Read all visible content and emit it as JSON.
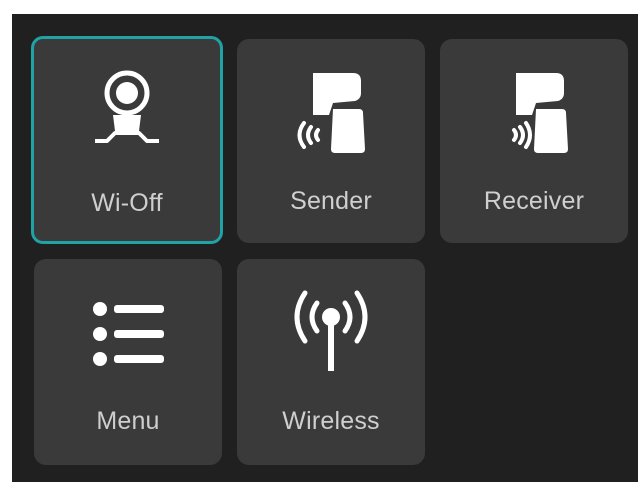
{
  "tiles": [
    {
      "id": "wi-off",
      "label": "Wi-Off",
      "icon": "webcam-icon",
      "selected": true
    },
    {
      "id": "sender",
      "label": "Sender",
      "icon": "sender-icon",
      "selected": false
    },
    {
      "id": "receiver",
      "label": "Receiver",
      "icon": "receiver-icon",
      "selected": false
    },
    {
      "id": "menu",
      "label": "Menu",
      "icon": "list-icon",
      "selected": false
    },
    {
      "id": "wireless",
      "label": "Wireless",
      "icon": "antenna-icon",
      "selected": false
    }
  ],
  "colors": {
    "background": "#202020",
    "tile": "#3a3a3a",
    "selected_border": "#1fa3a6",
    "label": "#cfcfcf",
    "icon": "#ffffff"
  }
}
